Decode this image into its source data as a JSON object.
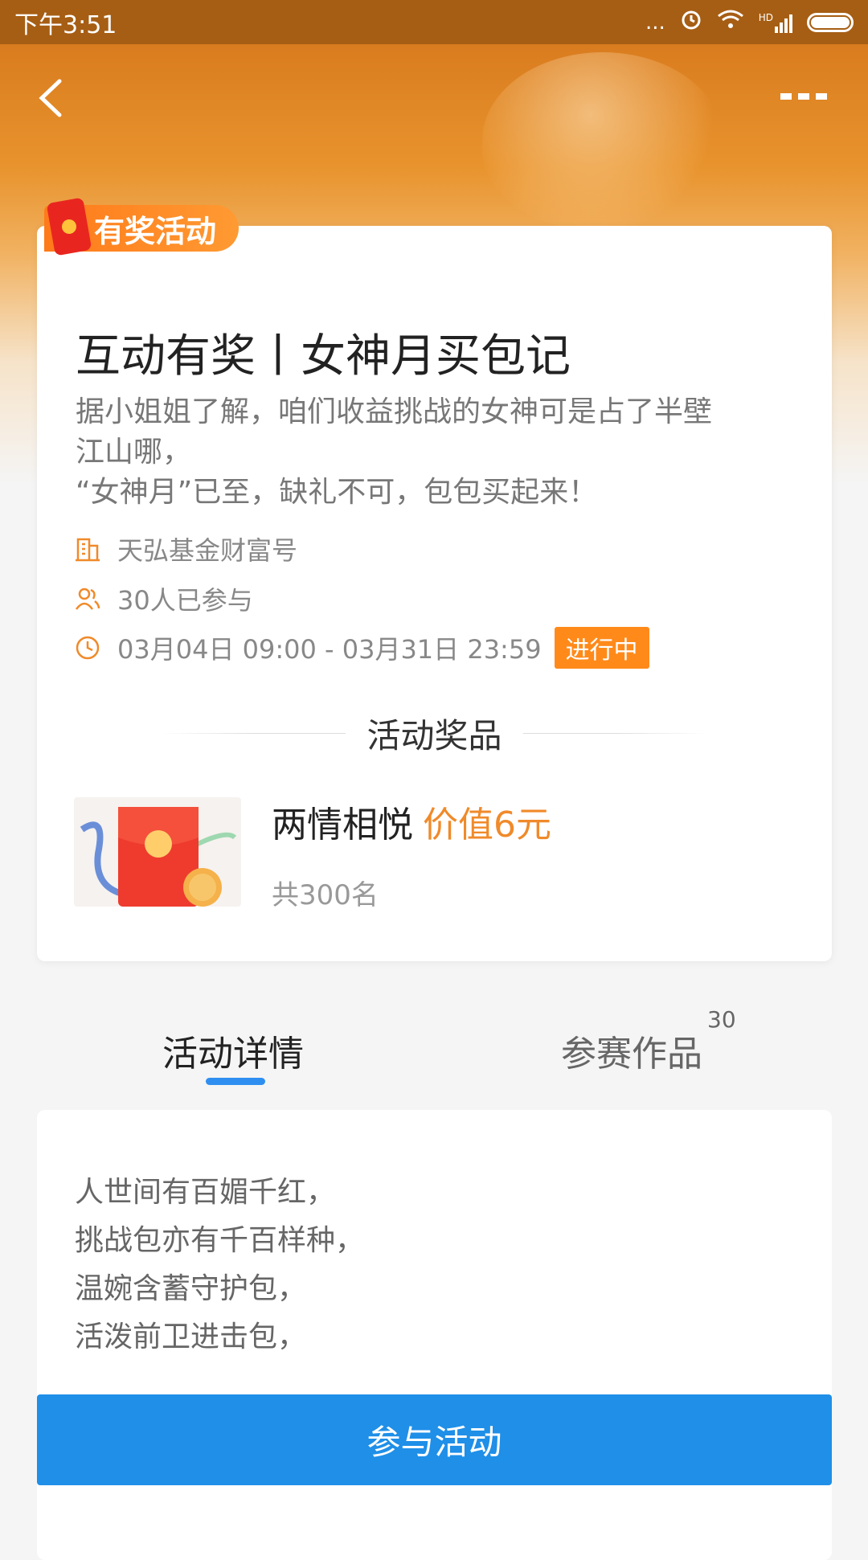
{
  "status_bar": {
    "time": "下午3:51",
    "dots": "...",
    "network": "HD"
  },
  "header": {
    "back_icon": "chevron-left-icon",
    "more_icon": "more-dots-icon"
  },
  "activity": {
    "tag": "有奖活动",
    "title": "互动有奖丨女神月买包记",
    "description_lines": [
      "据小姐姐了解，咱们收益挑战的女神可是占了半壁",
      "江山哪，",
      "“女神月”已至，缺礼不可，包包买起来！"
    ],
    "organizer": "天弘基金财富号",
    "participants": "30人已参与",
    "time_range": "03月04日 09:00 - 03月31日 23:59",
    "status": "进行中"
  },
  "prize_section": {
    "title": "活动奖品",
    "prize_name": "两情相悦",
    "prize_value": "价值6元",
    "prize_count": "共300名"
  },
  "tabs": [
    {
      "label": "活动详情",
      "active": true
    },
    {
      "label": "参赛作品",
      "count": "30",
      "active": false
    }
  ],
  "details": {
    "lines": [
      "人世间有百媚千红，",
      "挑战包亦有千百样种，",
      "温婉含蓄守护包，",
      "活泼前卫进击包，"
    ]
  },
  "join_button": "参与活动",
  "colors": {
    "accent_orange": "#ff8a1a",
    "accent_blue": "#1f8fe8"
  }
}
